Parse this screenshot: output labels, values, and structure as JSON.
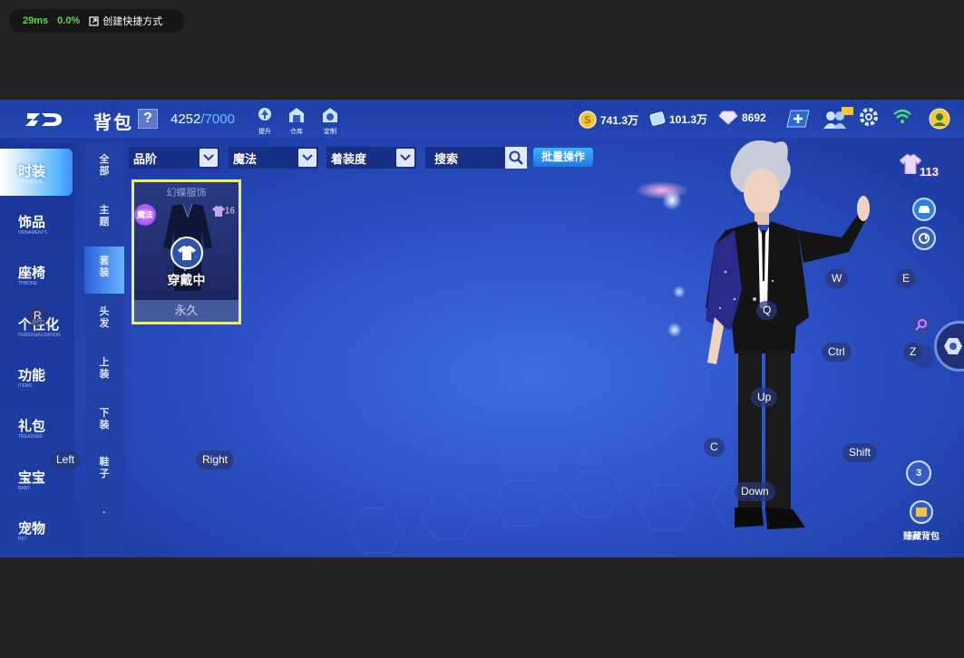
{
  "perf": {
    "latency": "29ms",
    "loss": "0.0%",
    "shortcut": "创建快捷方式"
  },
  "header": {
    "title": "背包",
    "help": "?",
    "capacity_used": "4252",
    "capacity_max": "/7000",
    "icons": [
      {
        "name": "upgrade-icon",
        "label": "提升"
      },
      {
        "name": "warehouse-icon",
        "label": "仓库"
      },
      {
        "name": "custom-icon",
        "label": "定制"
      }
    ],
    "currencies": [
      {
        "name": "gold-coin",
        "value": "741.3万"
      },
      {
        "name": "ticket",
        "value": "101.3万"
      },
      {
        "name": "diamond",
        "value": "8692"
      }
    ]
  },
  "left_nav": [
    {
      "cn": "时装",
      "en": "APPARELS",
      "active": true
    },
    {
      "cn": "饰品",
      "en": "ORNAMENTS"
    },
    {
      "cn": "座椅",
      "en": "THRONE"
    },
    {
      "cn": "个性化",
      "en": "PERSONALIZATION"
    },
    {
      "cn": "功能",
      "en": "ITEMS"
    },
    {
      "cn": "礼包",
      "en": "TREASURE"
    },
    {
      "cn": "宝宝",
      "en": "BABY"
    },
    {
      "cn": "宠物",
      "en": "PET"
    }
  ],
  "sub_nav": [
    {
      "label": "全部"
    },
    {
      "label": "主题"
    },
    {
      "label": "套装",
      "active": true
    },
    {
      "label": "头发"
    },
    {
      "label": "上装"
    },
    {
      "label": "下装"
    },
    {
      "label": "鞋子"
    }
  ],
  "filters": {
    "grade": "品阶",
    "magic": "魔法",
    "wear": "着装度",
    "search": "搜索",
    "bulk": "批量操作"
  },
  "item": {
    "name": "幻蝶服饰",
    "badge": "魔法",
    "level": "16",
    "status": "穿戴中",
    "duration": "永久"
  },
  "level_badge": "113",
  "keys": [
    {
      "label": "R"
    },
    {
      "label": "Left"
    },
    {
      "label": "Right"
    },
    {
      "label": "W"
    },
    {
      "label": "E"
    },
    {
      "label": "Q"
    },
    {
      "label": "Ctrl"
    },
    {
      "label": "Z"
    },
    {
      "label": "Up"
    },
    {
      "label": "C"
    },
    {
      "label": "Shift"
    },
    {
      "label": "Down"
    }
  ],
  "side_buttons": {
    "three": "3",
    "treasure_bag": "臻藏背包"
  }
}
